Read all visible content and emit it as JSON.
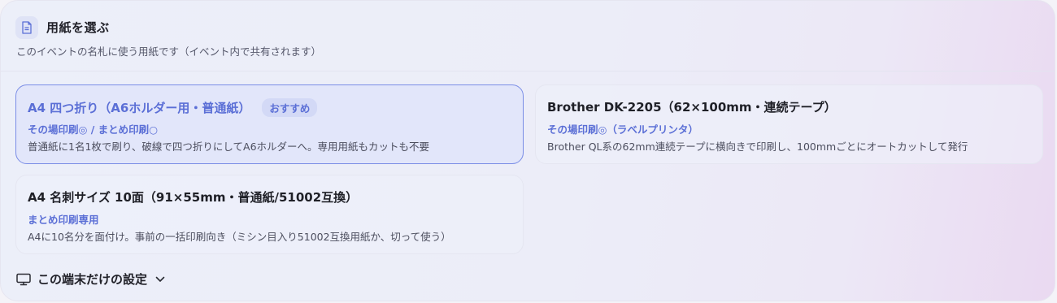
{
  "header": {
    "title": "用紙を選ぶ",
    "subtitle": "このイベントの名札に使う用紙です（イベント内で共有されます）",
    "icon": "document-icon"
  },
  "options": [
    {
      "title": "A4 四つ折り（A6ホルダー用・普通紙）",
      "badge": "おすすめ",
      "mode": "その場印刷◎ / まとめ印刷○",
      "desc": "普通紙に1名1枚で刷り、破線で四つ折りにしてA6ホルダーへ。専用用紙もカットも不要",
      "selected": true
    },
    {
      "title": "Brother DK-2205（62×100mm・連続テープ）",
      "mode": "その場印刷◎（ラベルプリンタ）",
      "desc": "Brother QL系の62mm連続テープに横向きで印刷し、100mmごとにオートカットして発行",
      "selected": false
    },
    {
      "title": "A4 名刺サイズ 10面（91×55mm・普通紙/51002互換）",
      "mode": "まとめ印刷専用",
      "desc": "A4に10名分を面付け。事前の一括印刷向き（ミシン目入り51002互換用紙か、切って使う）",
      "selected": false
    }
  ],
  "device_settings": {
    "label": "この端末だけの設定",
    "icon": "monitor-icon",
    "chevron": "chevron-down-icon"
  },
  "colors": {
    "accent": "#5b6fd6",
    "selected_border": "#7a8de6",
    "selected_bg": "#e2e6fa"
  }
}
